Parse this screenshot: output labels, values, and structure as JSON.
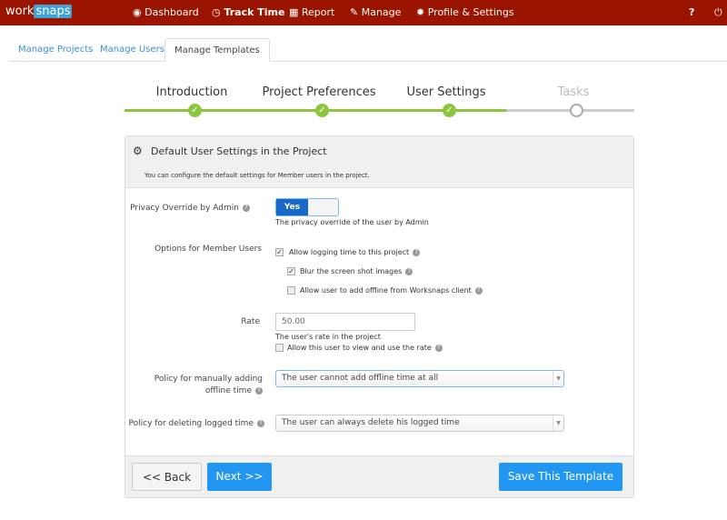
{
  "nav": {
    "logo_a": "work",
    "logo_b": "snaps",
    "items": [
      {
        "label": "Dashboard",
        "icon": "dashboard-icon"
      },
      {
        "label": "Track Time",
        "icon": "clock-icon",
        "active": true
      },
      {
        "label": "Report",
        "icon": "report-icon"
      },
      {
        "label": "Manage",
        "icon": "wrench-icon"
      },
      {
        "label": "Profile & Settings",
        "icon": "gear-icon"
      }
    ],
    "help": "?",
    "power": "⏻"
  },
  "tabs": [
    "Manage Projects",
    "Manage Users",
    "Manage Templates"
  ],
  "steps": [
    {
      "label": "Introduction",
      "done": true
    },
    {
      "label": "Project Preferences",
      "done": true
    },
    {
      "label": "User Settings",
      "done": true
    },
    {
      "label": "Tasks",
      "done": false
    }
  ],
  "colors": {
    "nav": "#9b1400",
    "step_done": "#8cc63f",
    "primary": "#2196f3"
  },
  "panel": {
    "title": "Default User Settings in the Project",
    "subtitle": "You can configure the default settings for Member users in the project.",
    "privacy_label": "Privacy Override by Admin",
    "privacy_value": "Yes",
    "privacy_help": "The privacy override of the user by Admin",
    "options_label": "Options for Member Users",
    "options": [
      {
        "label": "Allow logging time to this project",
        "checked": true
      },
      {
        "label": "Blur the screen shot images",
        "checked": true
      },
      {
        "label": "Allow user to add offline from Worksnaps client",
        "checked": false
      }
    ],
    "rate_label": "Rate",
    "rate_value": "50.00",
    "rate_help": "The user's rate in the project",
    "rate_option": "Allow this user to view and use the rate",
    "rate_option_checked": false,
    "policy_add_label_1": "Policy for manually adding",
    "policy_add_label_2": "offline time",
    "policy_add_value": "The user cannot add offline time at all",
    "policy_delete_label": "Policy for deleting logged time",
    "policy_delete_value": "The user can always delete his logged time"
  },
  "footer": {
    "back": "<< Back",
    "next": "Next >>",
    "save": "Save This Template"
  }
}
